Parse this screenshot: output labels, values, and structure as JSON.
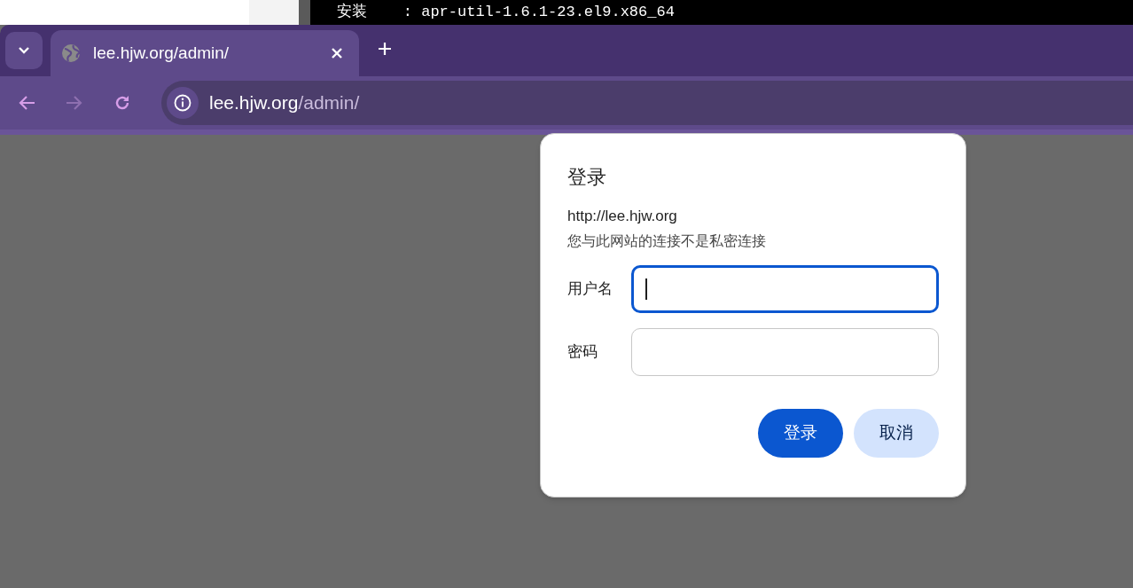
{
  "background_terminal": {
    "line": "安装    : apr-util-1.6.1-23.el9.x86_64"
  },
  "tabs": [
    {
      "title": "lee.hjw.org/admin/",
      "selected": true
    }
  ],
  "address_bar": {
    "host": "lee.hjw.org",
    "path": "/admin/"
  },
  "nav": {
    "back_disabled": false,
    "forward_disabled": true
  },
  "dialog": {
    "title": "登录",
    "origin": "http://lee.hjw.org",
    "warning": "您与此网站的连接不是私密连接",
    "fields": [
      {
        "label": "用户名",
        "focused": true
      },
      {
        "label": "密码",
        "focused": false
      }
    ],
    "buttons": [
      {
        "label": "登录",
        "kind": "primary"
      },
      {
        "label": "取消",
        "kind": "secondary"
      }
    ]
  }
}
